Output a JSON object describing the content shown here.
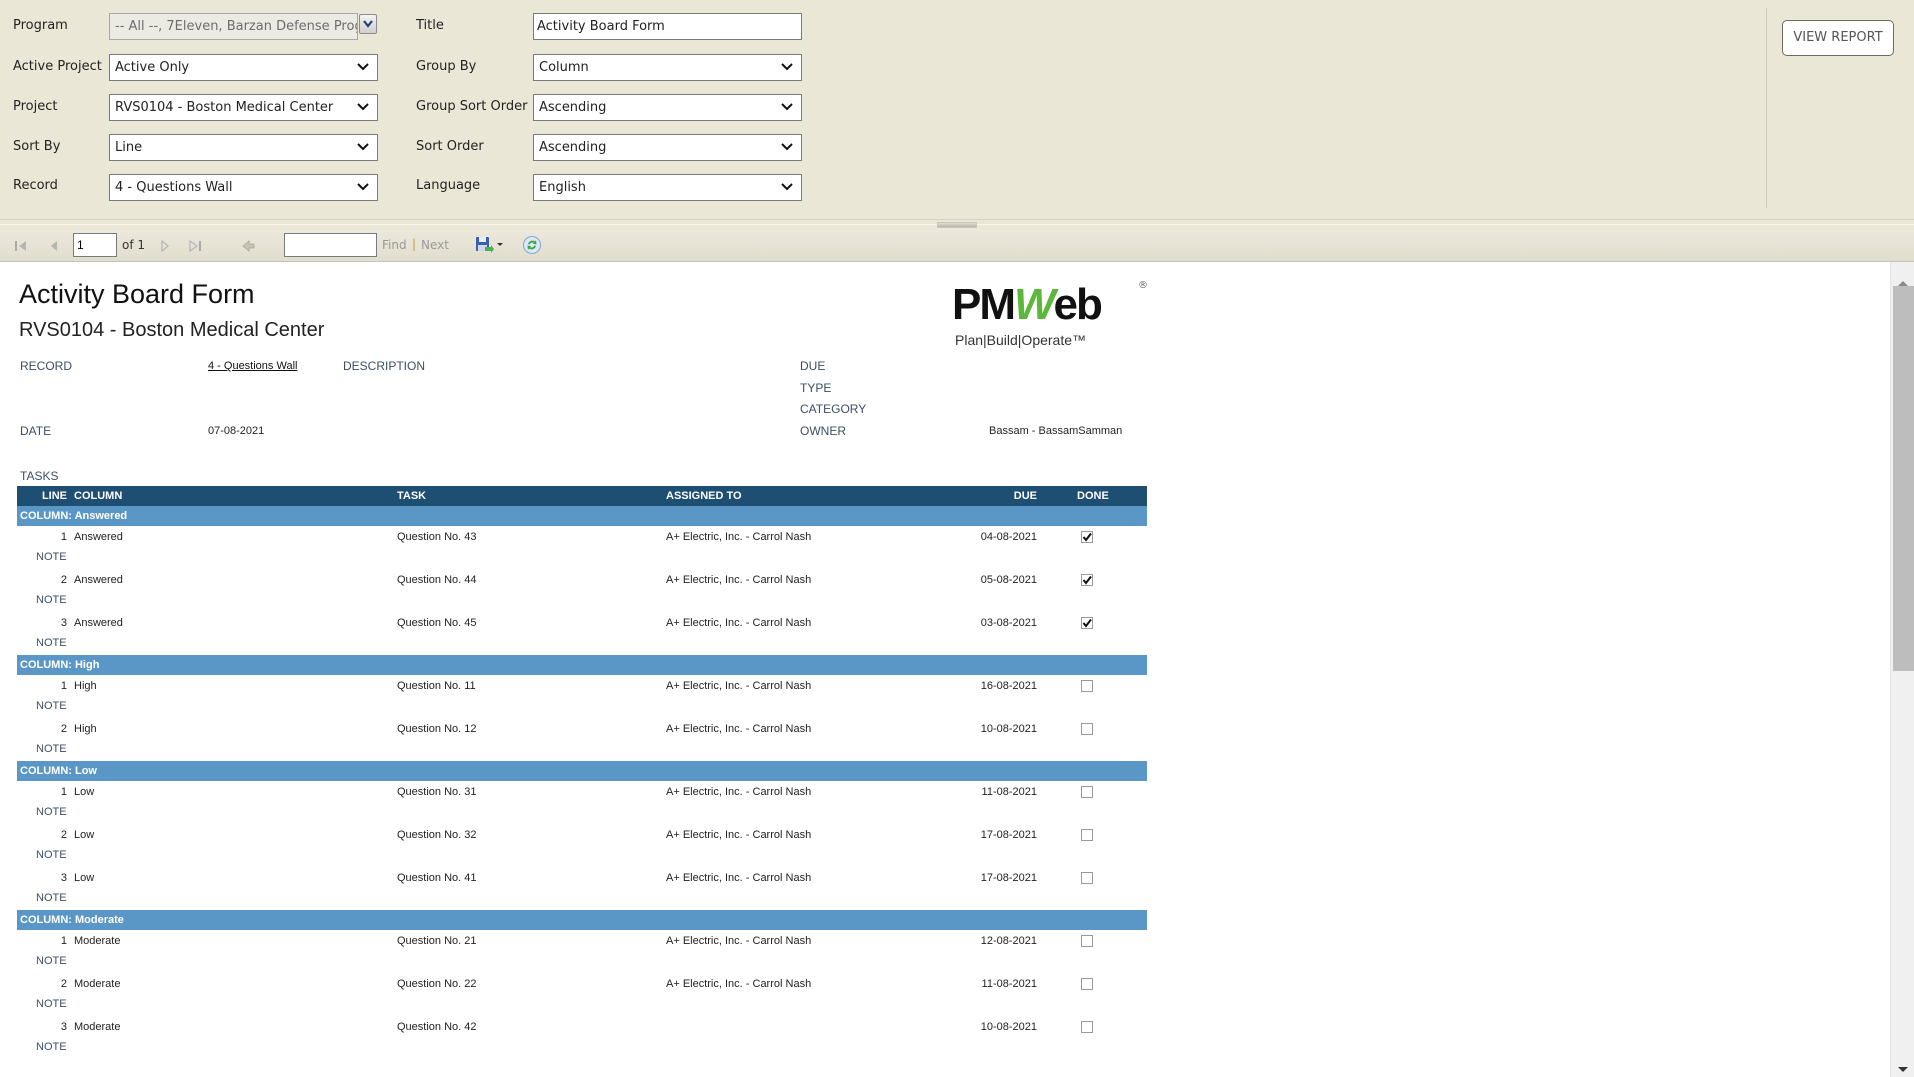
{
  "params": {
    "left": [
      {
        "label": "Program",
        "value": "-- All --, 7Eleven, Barzan Defense Progra",
        "disabled": true
      },
      {
        "label": "Active Project",
        "value": "Active Only"
      },
      {
        "label": "Project",
        "value": "RVS0104 - Boston Medical Center"
      },
      {
        "label": "Sort By",
        "value": "Line"
      },
      {
        "label": "Record",
        "value": "4 - Questions Wall"
      }
    ],
    "right": [
      {
        "label": "Title",
        "value": "Activity Board Form",
        "type": "text"
      },
      {
        "label": "Group By",
        "value": "Column"
      },
      {
        "label": "Group Sort Order",
        "value": "Ascending"
      },
      {
        "label": "Sort Order",
        "value": "Ascending"
      },
      {
        "label": "Language",
        "value": "English"
      }
    ],
    "view_report_label": "VIEW REPORT"
  },
  "toolbar": {
    "page_value": "1",
    "page_of": "of 1",
    "find_value": "",
    "find_label": "Find",
    "separator": "|",
    "next_label": "Next"
  },
  "report": {
    "title": "Activity Board Form",
    "subtitle": "RVS0104 - Boston Medical Center",
    "fields": {
      "record_label": "RECORD",
      "record_value": "4 - Questions Wall",
      "description_label": "DESCRIPTION",
      "date_label": "DATE",
      "date_value": "07-08-2021",
      "due_label": "DUE",
      "type_label": "TYPE",
      "category_label": "CATEGORY",
      "owner_label": "OWNER",
      "owner_value": "Bassam - BassamSamman",
      "tasks_label": "TASKS"
    },
    "logo": {
      "brand": "PMWeb",
      "tagline": "Plan|Build|Operate™",
      "registered": "®",
      "accent": "#5cb83a"
    },
    "table": {
      "headers": {
        "line": "LINE",
        "column": "COLUMN",
        "task": "TASK",
        "assigned": "ASSIGNED TO",
        "due": "DUE",
        "done": "DONE"
      },
      "note_label": "NOTE",
      "groups": [
        {
          "label": "COLUMN: Answered",
          "rows": [
            {
              "line": "1",
              "column": "Answered",
              "task": "Question No. 43",
              "assigned": "A+ Electric, Inc. - Carrol Nash",
              "due": "04-08-2021",
              "done": true
            },
            {
              "line": "2",
              "column": "Answered",
              "task": "Question No. 44",
              "assigned": "A+ Electric, Inc. - Carrol Nash",
              "due": "05-08-2021",
              "done": true
            },
            {
              "line": "3",
              "column": "Answered",
              "task": "Question No. 45",
              "assigned": "A+ Electric, Inc. - Carrol Nash",
              "due": "03-08-2021",
              "done": true
            }
          ]
        },
        {
          "label": "COLUMN: High",
          "rows": [
            {
              "line": "1",
              "column": "High",
              "task": "Question No. 11",
              "assigned": "A+ Electric, Inc. - Carrol Nash",
              "due": "16-08-2021",
              "done": false
            },
            {
              "line": "2",
              "column": "High",
              "task": "Question No. 12",
              "assigned": "A+ Electric, Inc. - Carrol Nash",
              "due": "10-08-2021",
              "done": false
            }
          ]
        },
        {
          "label": "COLUMN: Low",
          "rows": [
            {
              "line": "1",
              "column": "Low",
              "task": "Question No. 31",
              "assigned": "A+ Electric, Inc. - Carrol Nash",
              "due": "11-08-2021",
              "done": false
            },
            {
              "line": "2",
              "column": "Low",
              "task": "Question No. 32",
              "assigned": "A+ Electric, Inc. - Carrol Nash",
              "due": "17-08-2021",
              "done": false
            },
            {
              "line": "3",
              "column": "Low",
              "task": "Question No. 41",
              "assigned": "A+ Electric, Inc. - Carrol Nash",
              "due": "17-08-2021",
              "done": false
            }
          ]
        },
        {
          "label": "COLUMN: Moderate",
          "rows": [
            {
              "line": "1",
              "column": "Moderate",
              "task": "Question No. 21",
              "assigned": "A+ Electric, Inc. - Carrol Nash",
              "due": "12-08-2021",
              "done": false
            },
            {
              "line": "2",
              "column": "Moderate",
              "task": "Question No. 22",
              "assigned": "A+ Electric, Inc. - Carrol Nash",
              "due": "11-08-2021",
              "done": false
            },
            {
              "line": "3",
              "column": "Moderate",
              "task": "Question No. 42",
              "assigned": "",
              "due": "10-08-2021",
              "done": false
            }
          ]
        }
      ]
    }
  },
  "colors": {
    "panel_bg": "#ebe7d7",
    "table_header": "#1f4e73",
    "group_band": "#5b97c6",
    "label_blue": "#3c4e66"
  }
}
